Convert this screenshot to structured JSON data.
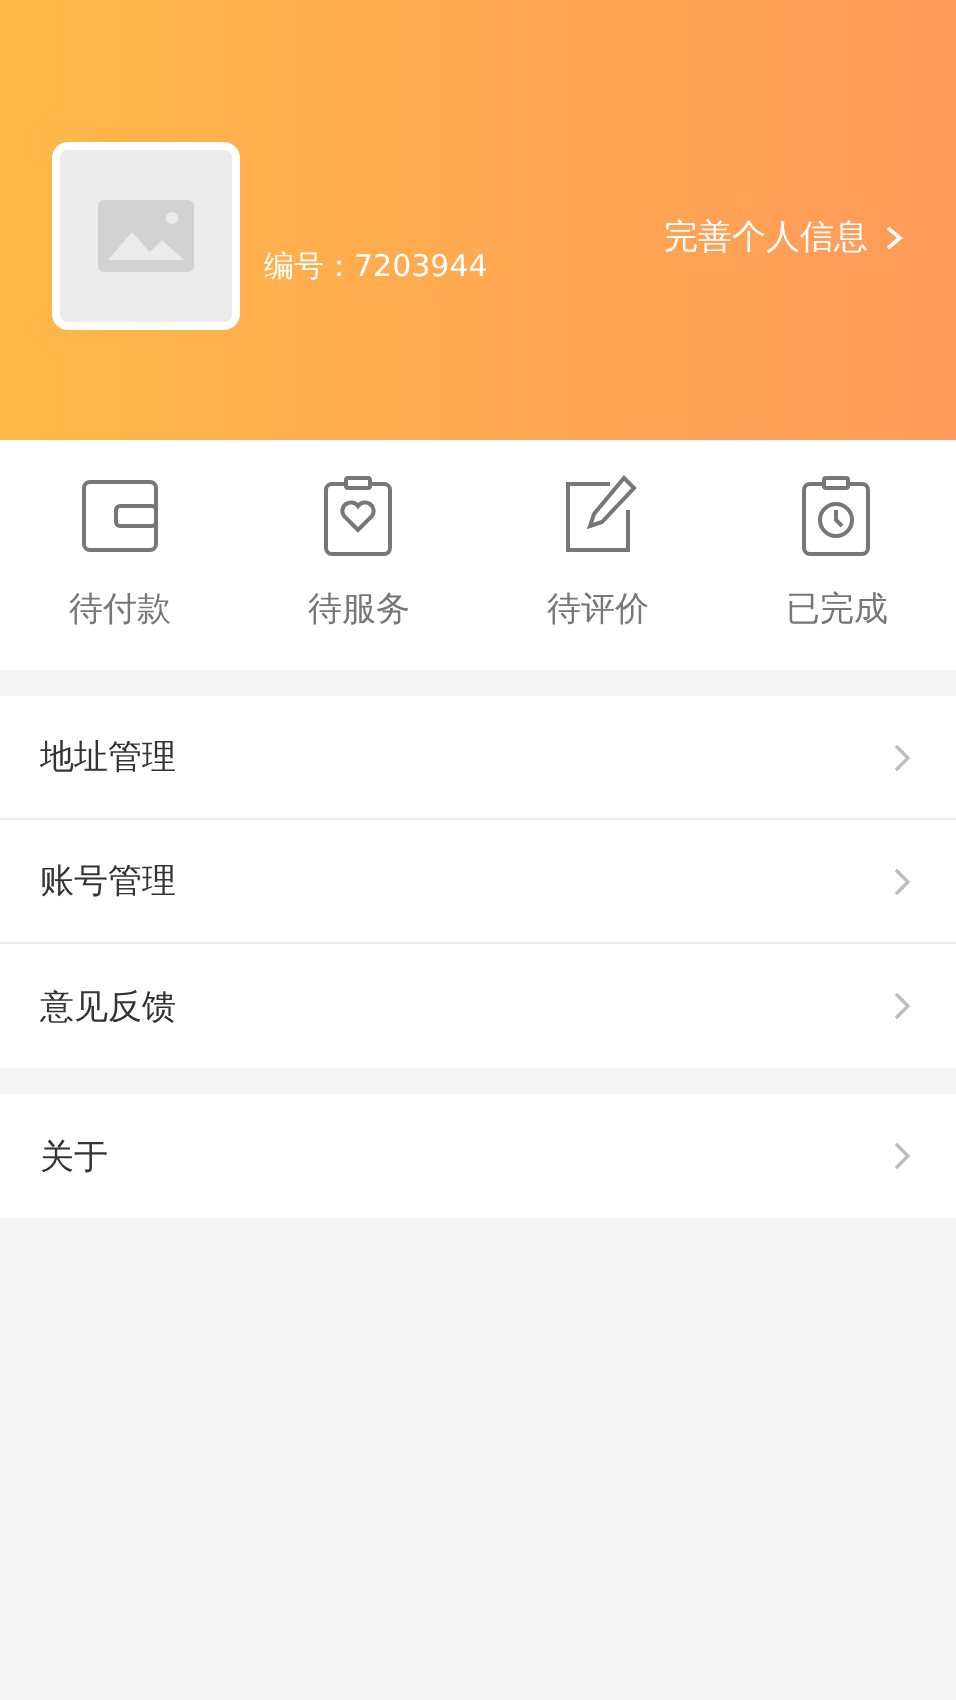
{
  "profile": {
    "member_id": "编号：7203944",
    "edit_link": "完善个人信息"
  },
  "orders": [
    {
      "kind": "wallet",
      "label": "待付款"
    },
    {
      "kind": "service",
      "label": "待服务"
    },
    {
      "kind": "review",
      "label": "待评价"
    },
    {
      "kind": "done",
      "label": "已完成"
    }
  ],
  "menu_groups": [
    {
      "items": [
        {
          "label": "地址管理"
        },
        {
          "label": "账号管理"
        },
        {
          "label": "意见反馈"
        }
      ]
    },
    {
      "items": [
        {
          "label": "关于"
        }
      ]
    }
  ]
}
